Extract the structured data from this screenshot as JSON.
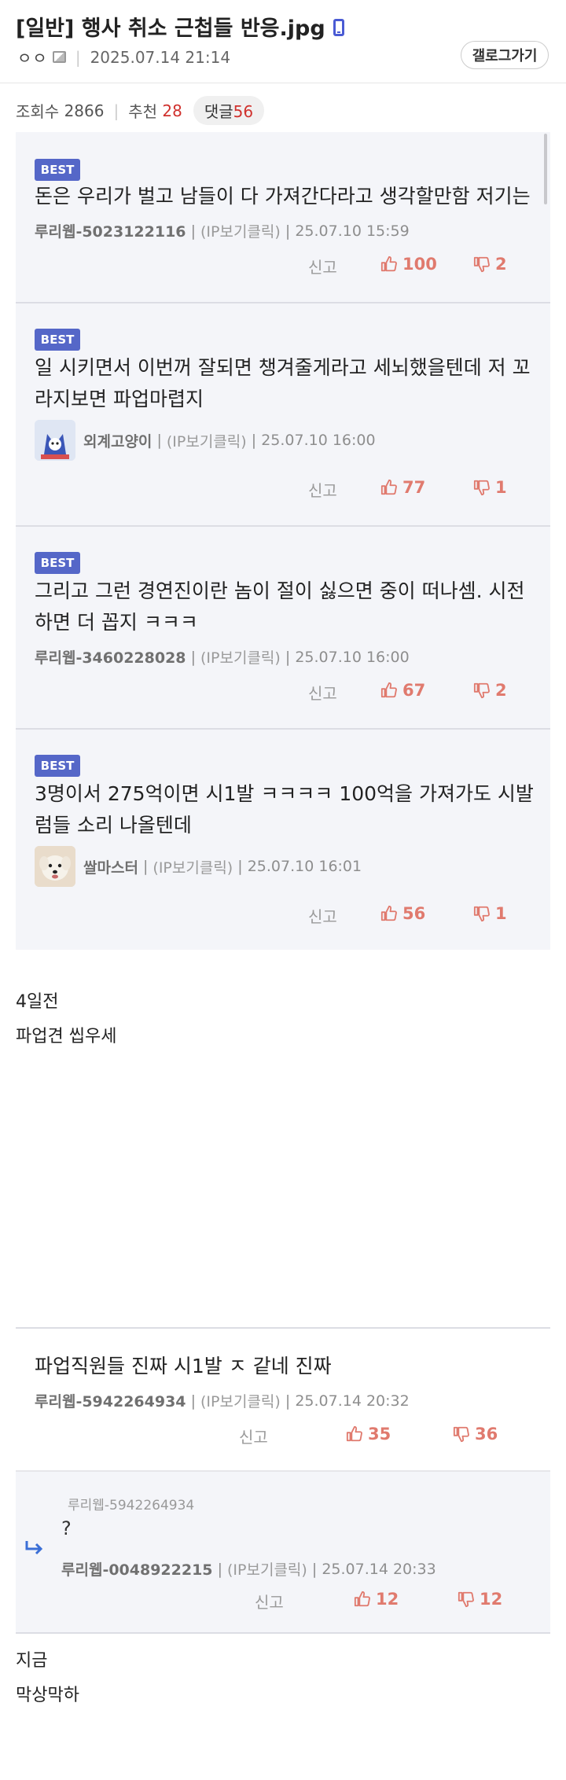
{
  "post": {
    "title": "[일반] 행사 취소 근첩들 반응.jpg",
    "author": "ㅇㅇ",
    "datetime": "2025.07.14 21:14",
    "gallery_button": "갤로그가기",
    "views_label": "조회수",
    "views": "2866",
    "recommend_label": "추천",
    "recommend": "28",
    "comments_label": "댓글",
    "comments": "56"
  },
  "labels": {
    "report": "신고",
    "ip_text": "(IP보기클릭)",
    "best": "BEST"
  },
  "best_comments": [
    {
      "text": "돈은 우리가 벌고 남들이 다 가져간다라고 생각할만함 저기는",
      "author": "루리웹-5023122116",
      "date": "25.07.10 15:59",
      "likes": "100",
      "dislikes": "2"
    },
    {
      "text": "일 시키면서 이번꺼 잘되면 챙겨줄게라고 세뇌했을텐데 저 꼬라지보면 파업마렵지",
      "author": "외계고양이",
      "date": "25.07.10 16:00",
      "likes": "77",
      "dislikes": "1"
    },
    {
      "text": "그리고 그런 경연진이란 놈이 절이 싫으면 중이 떠나셈. 시전하면 더 꼽지 ㅋㅋㅋ",
      "author": "루리웹-3460228028",
      "date": "25.07.10 16:00",
      "likes": "67",
      "dislikes": "2"
    },
    {
      "text": "3명이서 275억이면 시1발 ㅋㅋㅋㅋ 100억을 가져가도 시발럼들 소리 나올텐데",
      "author": "쌀마스터",
      "date": "25.07.10 16:01",
      "likes": "56",
      "dislikes": "1"
    }
  ],
  "body_lines": [
    "4일전",
    "파업견 씹우세",
    "지금",
    "막상막하"
  ],
  "comment": {
    "text": "파업직원들 진짜 시1발 ㅈ 같네 진짜",
    "author": "루리웹-5942264934",
    "date": "25.07.14 20:32",
    "likes": "35",
    "dislikes": "36"
  },
  "reply": {
    "to": "루리웹-5942264934",
    "text": "?",
    "author": "루리웹-0048922215",
    "date": "25.07.14 20:33",
    "likes": "12",
    "dislikes": "12"
  },
  "icons": [
    "phone-icon",
    "image-icon",
    "thumb-up-icon",
    "thumb-down-icon",
    "reply-arrow-icon"
  ],
  "colors": {
    "accent": "#5567c8",
    "vote": "#e07a6e",
    "recommend": "#d0312d"
  }
}
